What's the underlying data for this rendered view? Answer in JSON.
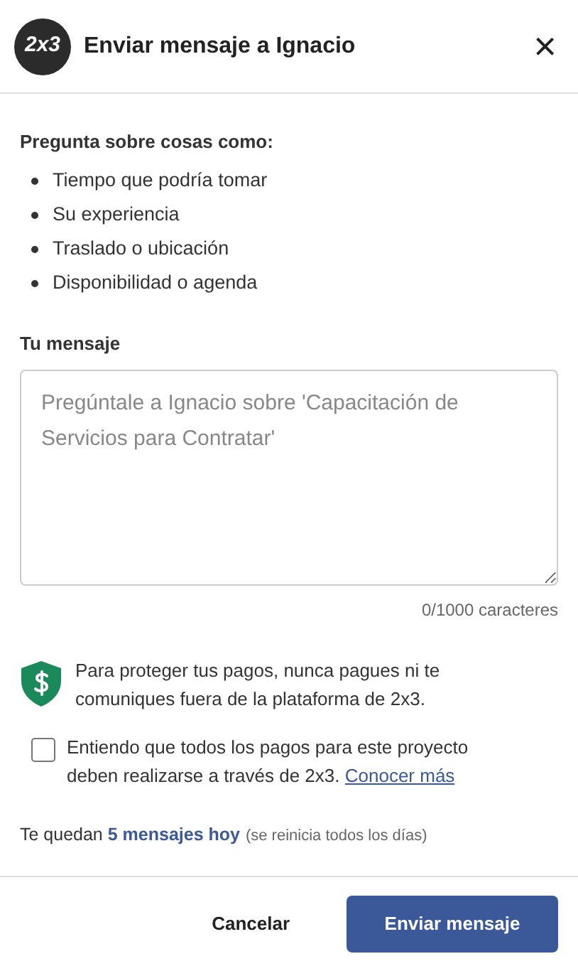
{
  "header": {
    "logo": "2x3",
    "title": "Enviar mensaje a Ignacio",
    "close": "×"
  },
  "tips": {
    "heading": "Pregunta sobre cosas como:",
    "items": [
      "Tiempo que podría tomar",
      "Su experiencia",
      "Traslado o ubicación",
      "Disponibilidad o agenda"
    ]
  },
  "message": {
    "label": "Tu mensaje",
    "placeholder": "Pregúntale a Ignacio sobre 'Capacitación de Servicios para Contratar'",
    "counter": "0/1000 caracteres"
  },
  "safety_note": "Para proteger tus pagos, nunca pagues ni te comuniques fuera de la plataforma de 2x3.",
  "agreement": {
    "checked": false,
    "text": "Entiendo que todos los pagos para este proyecto deben realizarse a través de 2x3.",
    "link": "Conocer más"
  },
  "quota": {
    "text": "Te quedan **5 mensajes hoy**",
    "note": "(se reinicia todos los días)"
  },
  "buttons": {
    "cancel": "Cancelar",
    "send": "Enviar mensaje"
  }
}
